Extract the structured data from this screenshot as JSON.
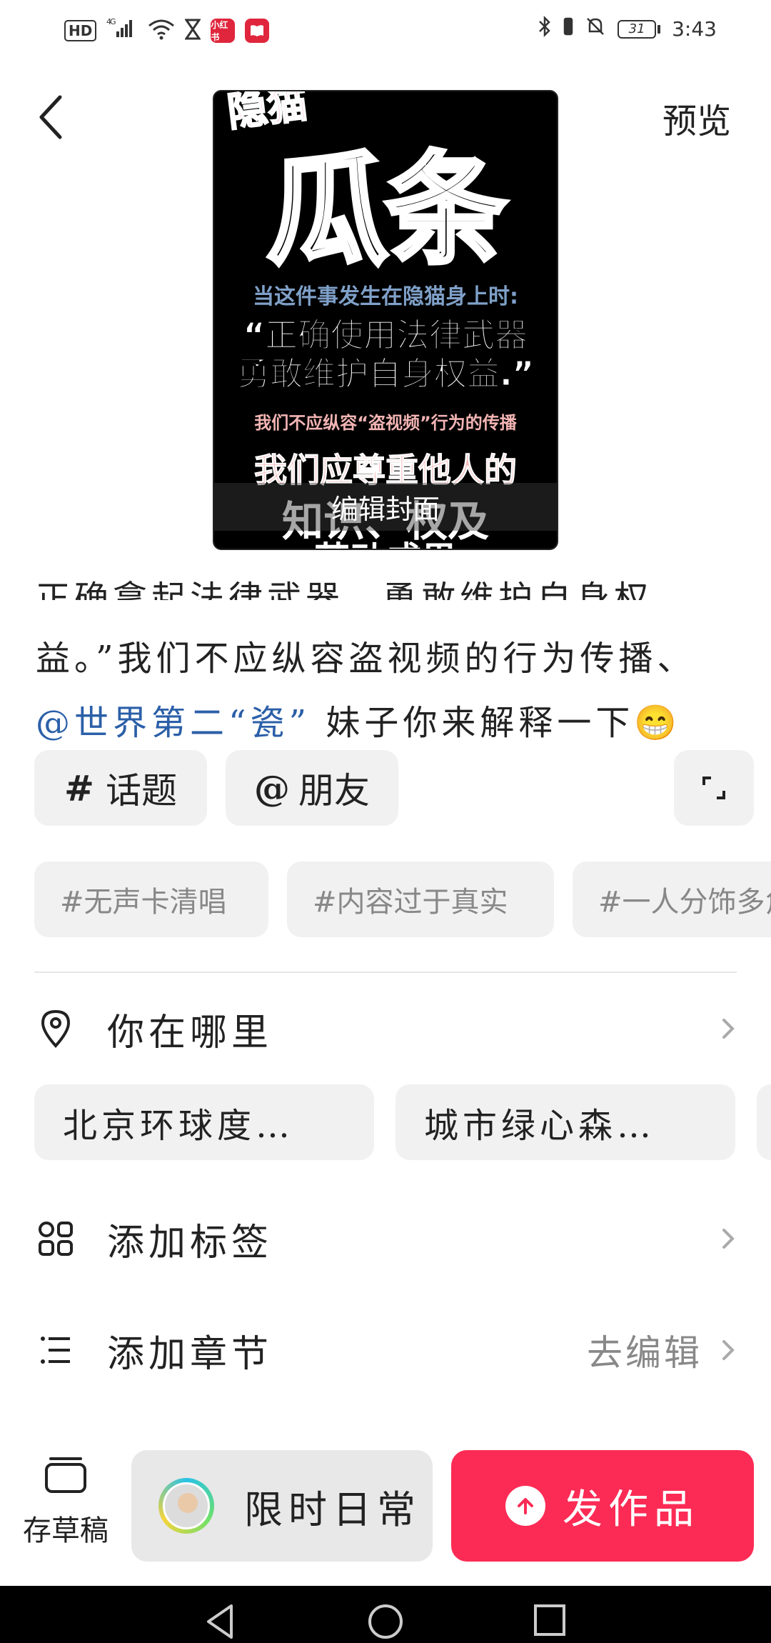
{
  "status_bar": {
    "hd": "HD",
    "network": "4G",
    "app_badge": "小红书",
    "battery": "31",
    "time": "3:43"
  },
  "header": {
    "preview_label": "预览"
  },
  "cover": {
    "pink_tag": "隐猫",
    "headline": "瓜条",
    "line1": "当这件事发生在隐猫身上时:",
    "line2a": "“正确使用法律武器",
    "line2b": "勇敢维护自身权益.”",
    "line3": "我们不应纵容“盗视频”行为的传播",
    "line4": "我们应尊重他人的",
    "line5": "知识、权及",
    "line6": "劳动成果",
    "edit_label": "编辑封面"
  },
  "description": {
    "line1": "正确拿起法律武器，勇敢维护自身权",
    "line2": "益。”我们不应纵容盗视频的行为传播、",
    "mention": "@世界第二“瓷”",
    "line3_rest": " 妹子你来解释一下😁"
  },
  "chips": {
    "hashtag_symbol": "#",
    "hashtag_label": "话题",
    "friend_symbol": "@",
    "friend_label": "朋友"
  },
  "topics": [
    "#无声卡清唱",
    "#内容过于真实",
    "#一人分饰多角"
  ],
  "location": {
    "label": "你在哪里",
    "suggestions": [
      "北京环球度…",
      "城市绿心森…"
    ]
  },
  "tags_row": {
    "label": "添加标签"
  },
  "chapter_row": {
    "label": "添加章节",
    "hint": "去编辑"
  },
  "bottom": {
    "draft_label": "存草稿",
    "daily_label": "限时日常",
    "publish_label": "发作品"
  },
  "colors": {
    "publish": "#fc2b55",
    "mention": "#2b5fa8",
    "chip_bg": "#f1f1f1"
  }
}
